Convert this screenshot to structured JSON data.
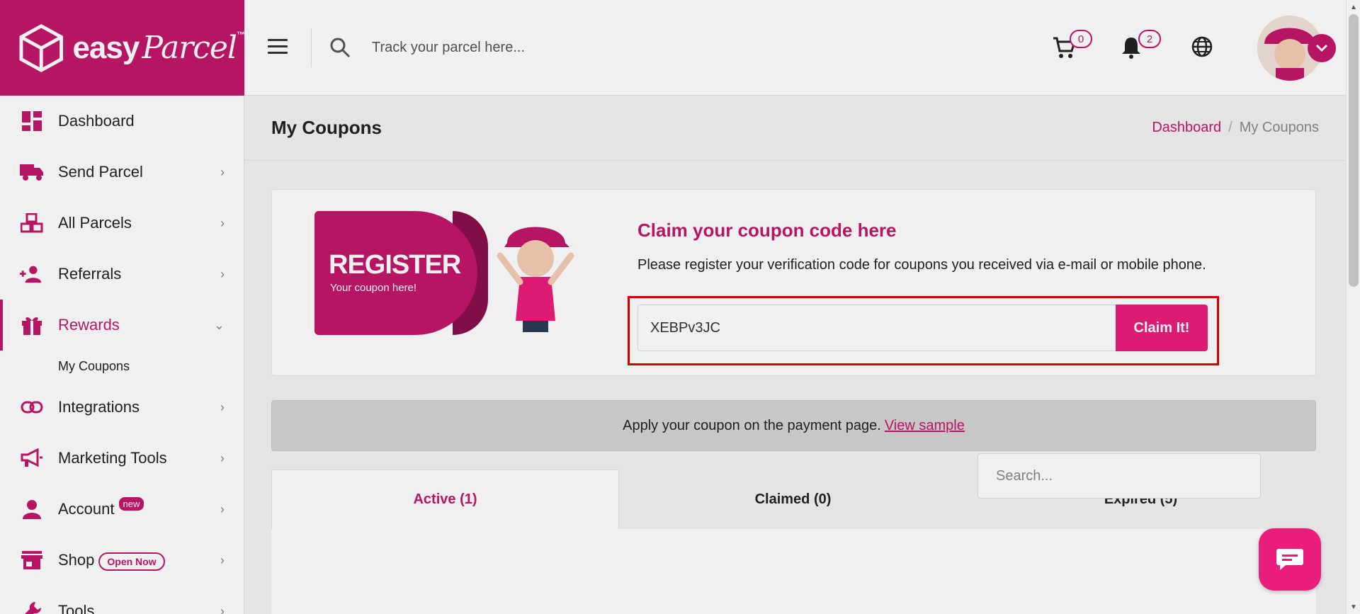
{
  "brand": {
    "name": "easy",
    "script": "Parcel",
    "tm": "™"
  },
  "header": {
    "search_placeholder": "Track your parcel here...",
    "cart_count": "0",
    "notification_count": "2"
  },
  "sidebar": {
    "items": [
      {
        "label": "Dashboard"
      },
      {
        "label": "Send Parcel"
      },
      {
        "label": "All Parcels"
      },
      {
        "label": "Referrals"
      },
      {
        "label": "Rewards"
      },
      {
        "label": "Integrations"
      },
      {
        "label": "Marketing Tools"
      },
      {
        "label": "Account",
        "badge": "new"
      },
      {
        "label": "Shop",
        "badge": "Open Now"
      },
      {
        "label": "Tools"
      }
    ],
    "sub_item": "My Coupons"
  },
  "page": {
    "title": "My Coupons",
    "breadcrumb": {
      "home": "Dashboard",
      "sep": "/",
      "current": "My Coupons"
    }
  },
  "claim": {
    "banner_title": "REGISTER",
    "banner_sub": "Your coupon here!",
    "heading": "Claim your coupon code here",
    "description": "Please register your verification code for coupons you received via e-mail or mobile phone.",
    "input_value": "XEBPv3JC",
    "button_label": "Claim It!"
  },
  "apply": {
    "text": "Apply your coupon on the payment page.",
    "link": "View sample"
  },
  "tabs": [
    {
      "label": "Active (1)"
    },
    {
      "label": "Claimed (0)"
    },
    {
      "label": "Expired (5)"
    }
  ],
  "list": {
    "search_placeholder": "Search..."
  },
  "colors": {
    "accent": "#c2176b",
    "button": "#e91e7a",
    "highlight": "#e00000"
  }
}
